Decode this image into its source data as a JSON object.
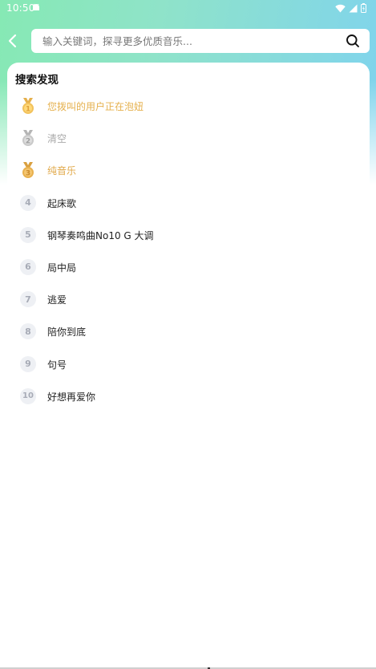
{
  "status_bar": {
    "time": "10:50"
  },
  "search": {
    "placeholder": "输入关键词，探寻更多优质音乐..."
  },
  "section": {
    "title": "搜索发现"
  },
  "rank_items": [
    {
      "rank": "1",
      "label": "您拨叫的用户正在泡妞",
      "tier": "gold"
    },
    {
      "rank": "2",
      "label": "清空",
      "tier": "silver"
    },
    {
      "rank": "3",
      "label": "纯音乐",
      "tier": "bronze"
    },
    {
      "rank": "4",
      "label": "起床歌",
      "tier": "normal"
    },
    {
      "rank": "5",
      "label": "钢琴奏鸣曲No10 G 大调",
      "tier": "normal"
    },
    {
      "rank": "6",
      "label": "局中局",
      "tier": "normal"
    },
    {
      "rank": "7",
      "label": "逃爱",
      "tier": "normal"
    },
    {
      "rank": "8",
      "label": "陪你到底",
      "tier": "normal"
    },
    {
      "rank": "9",
      "label": "句号",
      "tier": "normal"
    },
    {
      "rank": "10",
      "label": "好想再爱你",
      "tier": "normal"
    }
  ],
  "icons": {
    "back": "chevron-left-icon",
    "search": "search-icon",
    "medal": "medal-icon"
  },
  "colors": {
    "gradient_start": "#86e9b4",
    "gradient_end": "#7fd3ee",
    "gold": "#e5b04c",
    "silver": "#a9a9a9",
    "bronze": "#e1a94a",
    "rank_bg": "#eef0f4",
    "rank_text": "#a7abb6"
  }
}
